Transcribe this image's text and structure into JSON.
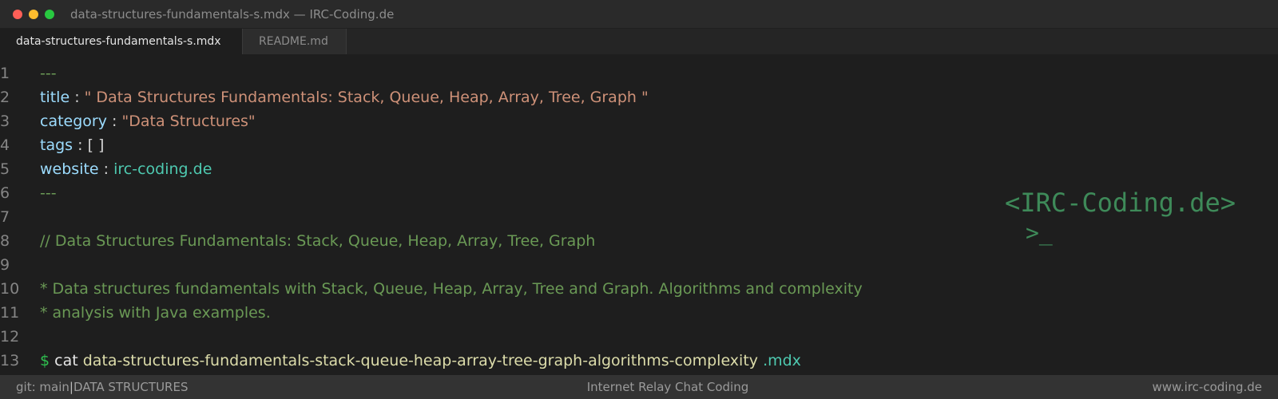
{
  "window": {
    "title": "data-structures-fundamentals-s.mdx — IRC-Coding.de"
  },
  "tabs": [
    {
      "label": "data-structures-fundamentals-s.mdx",
      "active": true
    },
    {
      "label": "README.md",
      "active": false
    }
  ],
  "editor": {
    "line_numbers": [
      "1",
      "2",
      "3",
      "4",
      "5",
      "6",
      "7",
      "8",
      "9",
      "10",
      "11",
      "12",
      "13"
    ],
    "frontmatter_delim": "---",
    "title_key": "title",
    "title_value": "\" Data Structures Fundamentals: Stack, Queue, Heap, Array, Tree, Graph \"",
    "category_key": "category",
    "category_value": "\"Data Structures\"",
    "tags_key": "tags",
    "tags_value": "[ ]",
    "website_key": "website",
    "website_value": "irc-coding.de",
    "colon": ":",
    "comment_line": "// Data Structures Fundamentals: Stack, Queue, Heap, Array, Tree, Graph",
    "desc_line_1": "* Data structures fundamentals with Stack, Queue, Heap, Array, Tree and Graph. Algorithms and complexity",
    "desc_line_2": "* analysis with Java examples.",
    "prompt_symbol": "$",
    "command": "cat",
    "filename": "data-structures-fundamentals-stack-queue-heap-array-tree-graph-algorithms-complexity",
    "extension": ".mdx"
  },
  "logo": {
    "line1": "<IRC-Coding.de>",
    "line2": ">_"
  },
  "statusbar": {
    "branch": "git: main",
    "separator": "|",
    "section": "DATA STRUCTURES",
    "center": "Internet Relay Chat Coding",
    "right": "www.irc-coding.de"
  },
  "colors": {
    "background": "#1e1e1e",
    "comment": "#6a9955",
    "key": "#9cdcfe",
    "string": "#ce9178",
    "link": "#4ec9b0",
    "prompt": "#2fbf4f",
    "logo": "#3e8a59"
  }
}
